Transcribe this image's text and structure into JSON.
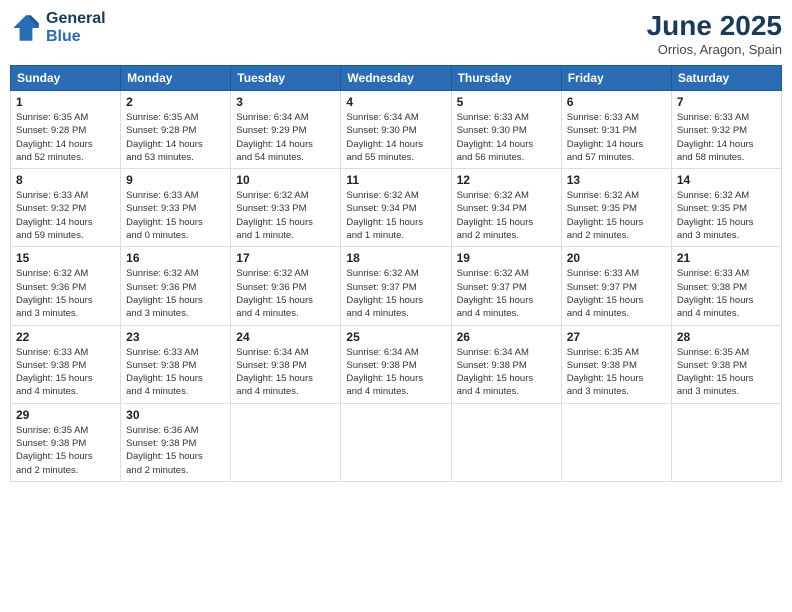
{
  "logo": {
    "line1": "General",
    "line2": "Blue"
  },
  "title": "June 2025",
  "subtitle": "Orrios, Aragon, Spain",
  "weekdays": [
    "Sunday",
    "Monday",
    "Tuesday",
    "Wednesday",
    "Thursday",
    "Friday",
    "Saturday"
  ],
  "weeks": [
    [
      {
        "day": "1",
        "info": "Sunrise: 6:35 AM\nSunset: 9:28 PM\nDaylight: 14 hours\nand 52 minutes."
      },
      {
        "day": "2",
        "info": "Sunrise: 6:35 AM\nSunset: 9:28 PM\nDaylight: 14 hours\nand 53 minutes."
      },
      {
        "day": "3",
        "info": "Sunrise: 6:34 AM\nSunset: 9:29 PM\nDaylight: 14 hours\nand 54 minutes."
      },
      {
        "day": "4",
        "info": "Sunrise: 6:34 AM\nSunset: 9:30 PM\nDaylight: 14 hours\nand 55 minutes."
      },
      {
        "day": "5",
        "info": "Sunrise: 6:33 AM\nSunset: 9:30 PM\nDaylight: 14 hours\nand 56 minutes."
      },
      {
        "day": "6",
        "info": "Sunrise: 6:33 AM\nSunset: 9:31 PM\nDaylight: 14 hours\nand 57 minutes."
      },
      {
        "day": "7",
        "info": "Sunrise: 6:33 AM\nSunset: 9:32 PM\nDaylight: 14 hours\nand 58 minutes."
      }
    ],
    [
      {
        "day": "8",
        "info": "Sunrise: 6:33 AM\nSunset: 9:32 PM\nDaylight: 14 hours\nand 59 minutes."
      },
      {
        "day": "9",
        "info": "Sunrise: 6:33 AM\nSunset: 9:33 PM\nDaylight: 15 hours\nand 0 minutes."
      },
      {
        "day": "10",
        "info": "Sunrise: 6:32 AM\nSunset: 9:33 PM\nDaylight: 15 hours\nand 1 minute."
      },
      {
        "day": "11",
        "info": "Sunrise: 6:32 AM\nSunset: 9:34 PM\nDaylight: 15 hours\nand 1 minute."
      },
      {
        "day": "12",
        "info": "Sunrise: 6:32 AM\nSunset: 9:34 PM\nDaylight: 15 hours\nand 2 minutes."
      },
      {
        "day": "13",
        "info": "Sunrise: 6:32 AM\nSunset: 9:35 PM\nDaylight: 15 hours\nand 2 minutes."
      },
      {
        "day": "14",
        "info": "Sunrise: 6:32 AM\nSunset: 9:35 PM\nDaylight: 15 hours\nand 3 minutes."
      }
    ],
    [
      {
        "day": "15",
        "info": "Sunrise: 6:32 AM\nSunset: 9:36 PM\nDaylight: 15 hours\nand 3 minutes."
      },
      {
        "day": "16",
        "info": "Sunrise: 6:32 AM\nSunset: 9:36 PM\nDaylight: 15 hours\nand 3 minutes."
      },
      {
        "day": "17",
        "info": "Sunrise: 6:32 AM\nSunset: 9:36 PM\nDaylight: 15 hours\nand 4 minutes."
      },
      {
        "day": "18",
        "info": "Sunrise: 6:32 AM\nSunset: 9:37 PM\nDaylight: 15 hours\nand 4 minutes."
      },
      {
        "day": "19",
        "info": "Sunrise: 6:32 AM\nSunset: 9:37 PM\nDaylight: 15 hours\nand 4 minutes."
      },
      {
        "day": "20",
        "info": "Sunrise: 6:33 AM\nSunset: 9:37 PM\nDaylight: 15 hours\nand 4 minutes."
      },
      {
        "day": "21",
        "info": "Sunrise: 6:33 AM\nSunset: 9:38 PM\nDaylight: 15 hours\nand 4 minutes."
      }
    ],
    [
      {
        "day": "22",
        "info": "Sunrise: 6:33 AM\nSunset: 9:38 PM\nDaylight: 15 hours\nand 4 minutes."
      },
      {
        "day": "23",
        "info": "Sunrise: 6:33 AM\nSunset: 9:38 PM\nDaylight: 15 hours\nand 4 minutes."
      },
      {
        "day": "24",
        "info": "Sunrise: 6:34 AM\nSunset: 9:38 PM\nDaylight: 15 hours\nand 4 minutes."
      },
      {
        "day": "25",
        "info": "Sunrise: 6:34 AM\nSunset: 9:38 PM\nDaylight: 15 hours\nand 4 minutes."
      },
      {
        "day": "26",
        "info": "Sunrise: 6:34 AM\nSunset: 9:38 PM\nDaylight: 15 hours\nand 4 minutes."
      },
      {
        "day": "27",
        "info": "Sunrise: 6:35 AM\nSunset: 9:38 PM\nDaylight: 15 hours\nand 3 minutes."
      },
      {
        "day": "28",
        "info": "Sunrise: 6:35 AM\nSunset: 9:38 PM\nDaylight: 15 hours\nand 3 minutes."
      }
    ],
    [
      {
        "day": "29",
        "info": "Sunrise: 6:35 AM\nSunset: 9:38 PM\nDaylight: 15 hours\nand 2 minutes."
      },
      {
        "day": "30",
        "info": "Sunrise: 6:36 AM\nSunset: 9:38 PM\nDaylight: 15 hours\nand 2 minutes."
      },
      {
        "day": "",
        "info": ""
      },
      {
        "day": "",
        "info": ""
      },
      {
        "day": "",
        "info": ""
      },
      {
        "day": "",
        "info": ""
      },
      {
        "day": "",
        "info": ""
      }
    ]
  ]
}
